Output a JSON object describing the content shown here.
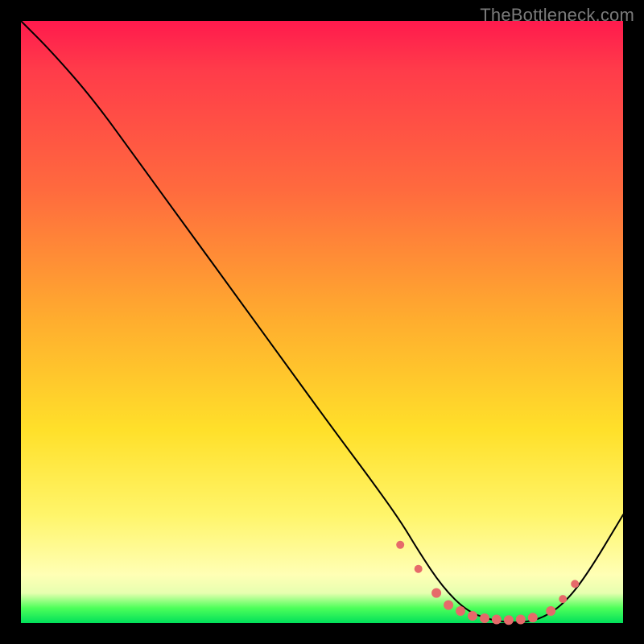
{
  "watermark": "TheBottleneck.com",
  "colors": {
    "bg": "#000000",
    "curve": "#000000",
    "marker": "#e66a6a",
    "gradient_stops": [
      "#ff1a4d",
      "#ff6a3e",
      "#ffae2e",
      "#ffe02a",
      "#fff56a",
      "#ffffb5",
      "#4eff5a",
      "#00e05a"
    ]
  },
  "chart_data": {
    "type": "line",
    "title": "",
    "xlabel": "",
    "ylabel": "",
    "xlim": [
      0,
      100
    ],
    "ylim": [
      0,
      100
    ],
    "grid": false,
    "legend": false,
    "notes": "Bottleneck-style curve on rainbow background. Y is high=top (worse), valley near x≈74–88 at y≈0. No axis ticks or labels visible.",
    "series": [
      {
        "name": "curve",
        "x": [
          0,
          5,
          12,
          20,
          28,
          36,
          44,
          52,
          58,
          63,
          66,
          70,
          74,
          78,
          82,
          86,
          90,
          94,
          100
        ],
        "y": [
          100,
          95,
          87,
          76,
          65,
          54,
          43,
          32,
          24,
          17,
          12,
          6,
          2,
          0.5,
          0,
          0.5,
          3,
          8,
          18
        ]
      }
    ],
    "markers": {
      "name": "flat-zone-dots",
      "x": [
        63,
        66,
        69,
        71,
        73,
        75,
        77,
        79,
        81,
        83,
        85,
        88,
        90,
        92
      ],
      "y": [
        13,
        9,
        5,
        3,
        2,
        1.2,
        0.8,
        0.6,
        0.5,
        0.6,
        0.9,
        2,
        4,
        6.5
      ],
      "r": [
        5,
        5,
        6,
        6,
        6,
        6,
        6,
        6,
        6,
        6,
        6,
        6,
        5,
        5
      ]
    }
  }
}
